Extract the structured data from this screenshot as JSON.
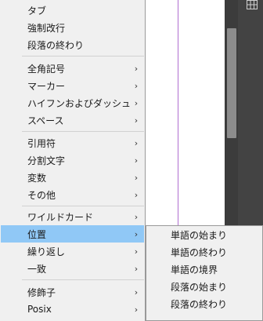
{
  "menu": {
    "items": [
      {
        "label": "タブ",
        "has_submenu": false
      },
      {
        "label": "強制改行",
        "has_submenu": false
      },
      {
        "label": "段落の終わり",
        "has_submenu": false
      },
      {
        "label": "全角記号",
        "has_submenu": true
      },
      {
        "label": "マーカー",
        "has_submenu": true
      },
      {
        "label": "ハイフンおよびダッシュ",
        "has_submenu": true
      },
      {
        "label": "スペース",
        "has_submenu": true
      },
      {
        "label": "引用符",
        "has_submenu": true
      },
      {
        "label": "分割文字",
        "has_submenu": true
      },
      {
        "label": "変数",
        "has_submenu": true
      },
      {
        "label": "その他",
        "has_submenu": true
      },
      {
        "label": "ワイルドカード",
        "has_submenu": true
      },
      {
        "label": "位置",
        "has_submenu": true,
        "active": true
      },
      {
        "label": "繰り返し",
        "has_submenu": true
      },
      {
        "label": "一致",
        "has_submenu": true
      },
      {
        "label": "修飾子",
        "has_submenu": true
      },
      {
        "label": "Posix",
        "has_submenu": true
      }
    ],
    "arrow_glyph": "›"
  },
  "submenu": {
    "items": [
      {
        "label": "単語の始まり"
      },
      {
        "label": "単語の終わり"
      },
      {
        "label": "単語の境界"
      },
      {
        "label": "段落の始まり"
      },
      {
        "label": "段落の終わり"
      }
    ]
  },
  "colors": {
    "menu_background": "#f0f0f0",
    "active_highlight": "#90c8f6",
    "guide_line": "#b06fd0",
    "app_dark": "#434343"
  },
  "icons": {
    "panel_icon": "grid-icon"
  }
}
